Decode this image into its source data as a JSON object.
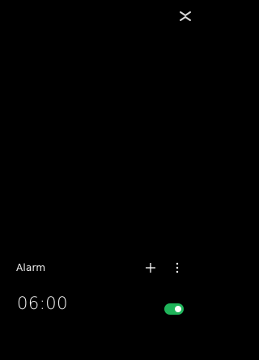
{
  "top_icon": {
    "name": "capcut-logo-icon"
  },
  "alarm_section": {
    "title": "Alarm",
    "add_icon": "plus-icon",
    "more_icon": "vertical-ellipsis-icon"
  },
  "alarms": [
    {
      "time": "06:00",
      "enabled": true
    }
  ],
  "colors": {
    "background": "#000000",
    "text": "#ffffff",
    "toggle_on": "#1fb45a"
  }
}
